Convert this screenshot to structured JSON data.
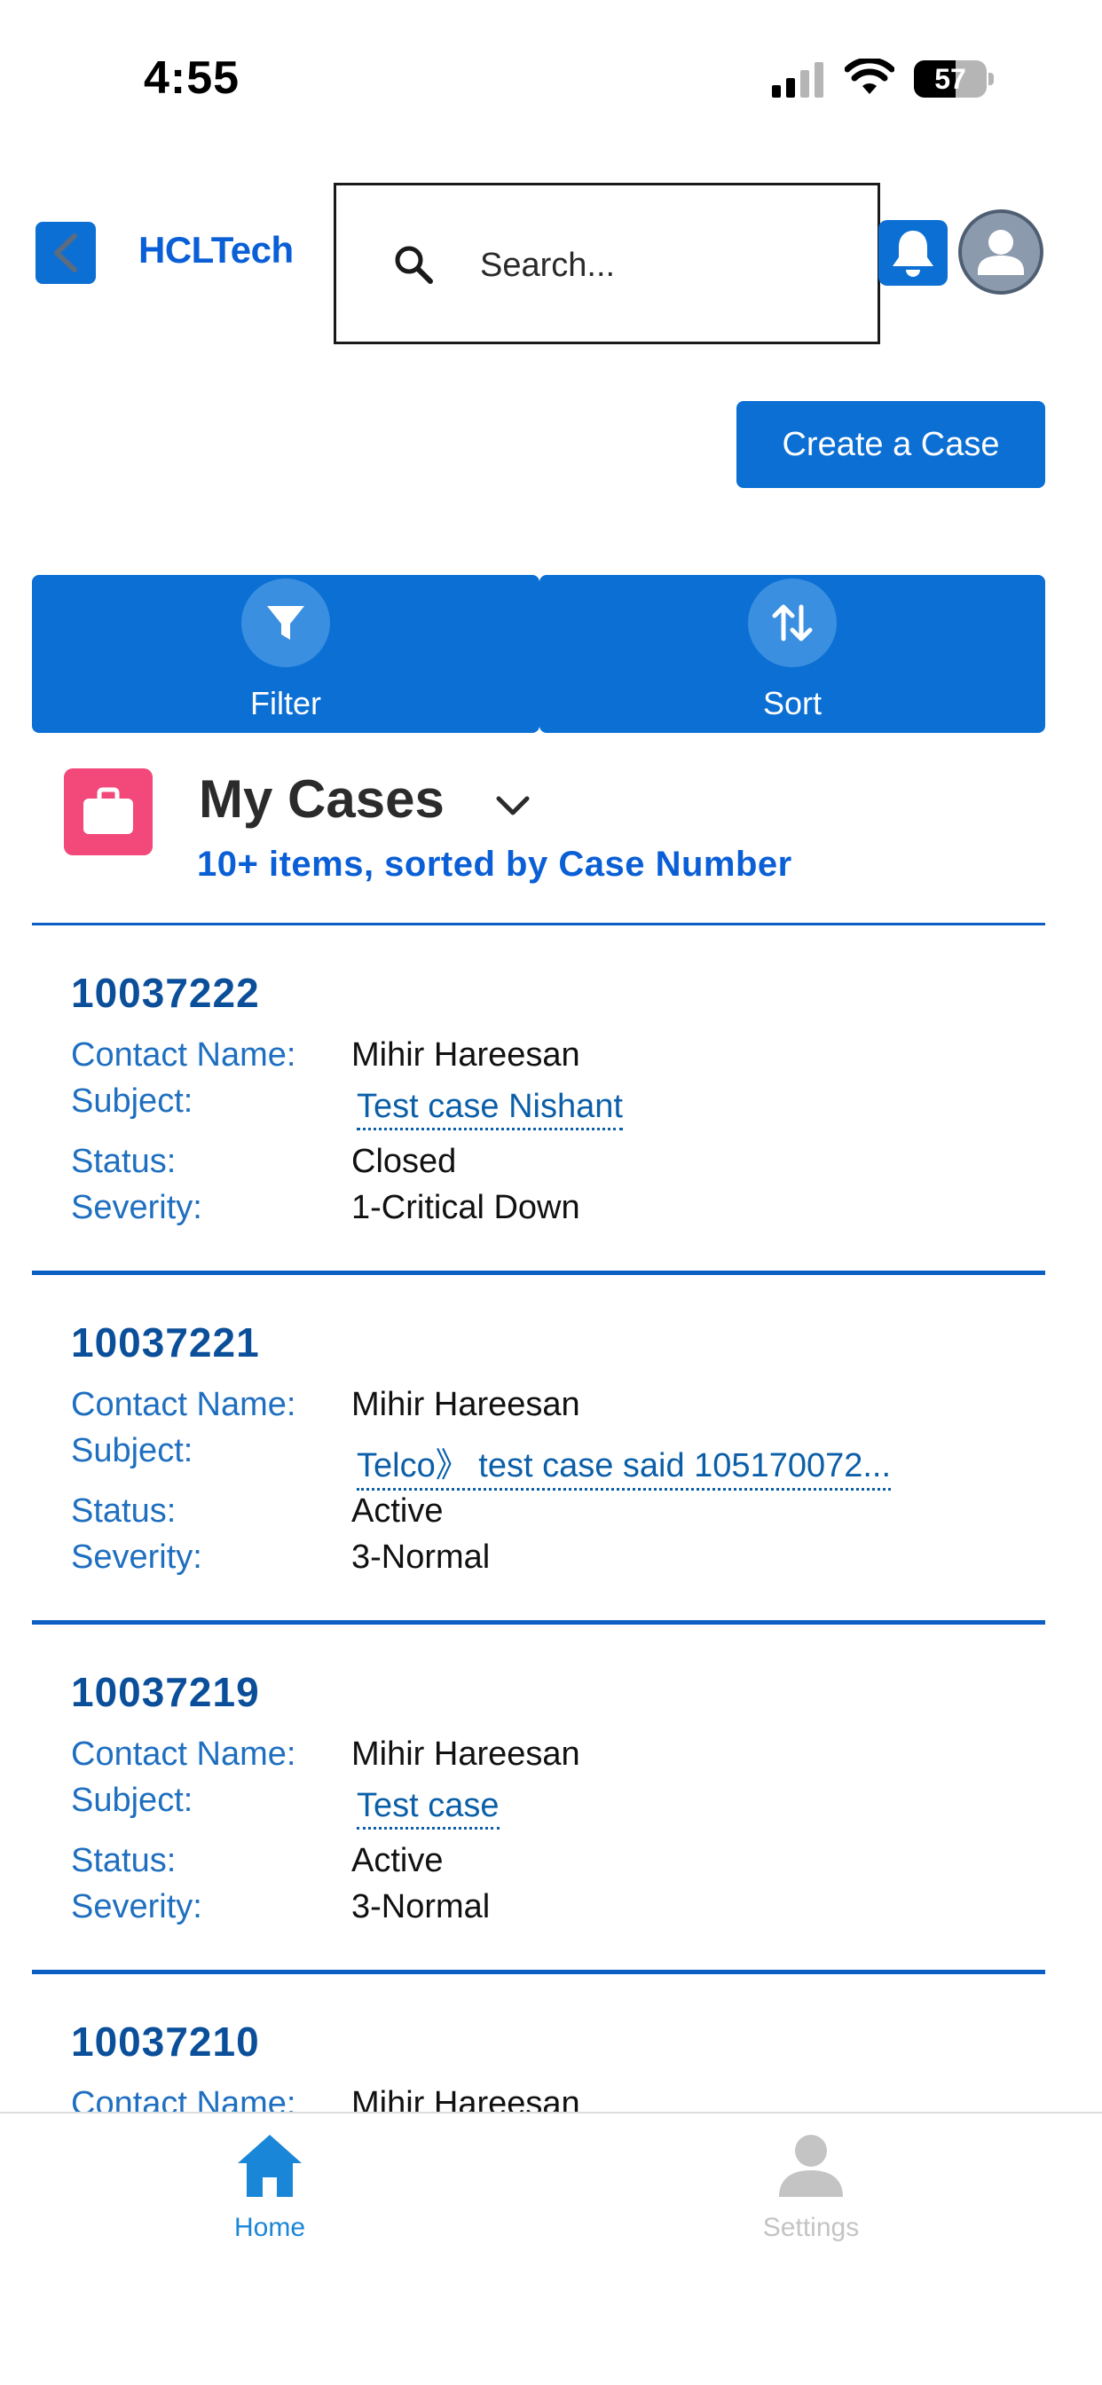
{
  "status_bar": {
    "time": "4:55",
    "battery": "57",
    "battery_level": 0.57
  },
  "header": {
    "logo": "HCLTech",
    "back_icon": "chevron-left-icon",
    "bell_icon": "bell-icon",
    "avatar_icon": "user-icon",
    "accent_color": "#0b6fd4"
  },
  "search": {
    "placeholder": "Search...",
    "value": ""
  },
  "create_case_label": "Create a Case",
  "actions": {
    "filter_label": "Filter",
    "sort_label": "Sort"
  },
  "list": {
    "title": "My Cases",
    "subtitle": "10+ items, sorted by Case Number",
    "icon": "briefcase-icon",
    "icon_color": "#f2487a"
  },
  "labels": {
    "contact_name": "Contact Name:",
    "subject": "Subject:",
    "status": "Status:",
    "severity": "Severity:"
  },
  "cases": [
    {
      "number": "10037222",
      "contact_name": "Mihir Hareesan",
      "subject": "Test case Nishant",
      "status": "Closed",
      "severity": "1-Critical Down"
    },
    {
      "number": "10037221",
      "contact_name": "Mihir Hareesan",
      "subject": "Telco》 test case said 105170072...",
      "status": "Active",
      "severity": "3-Normal"
    },
    {
      "number": "10037219",
      "contact_name": "Mihir Hareesan",
      "subject": "Test case",
      "status": "Active",
      "severity": "3-Normal"
    },
    {
      "number": "10037210",
      "contact_name": "Mihir Hareesan"
    }
  ],
  "tabs": {
    "home_label": "Home",
    "settings_label": "Settings",
    "home_icon": "home-icon",
    "settings_icon": "person-icon",
    "active_color": "#1a86d8"
  }
}
